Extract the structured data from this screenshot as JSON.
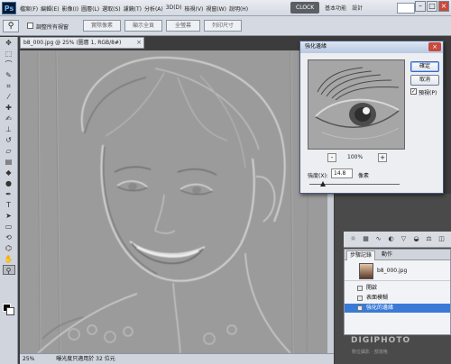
{
  "app": {
    "logo": "Ps"
  },
  "menu": {
    "items": [
      "檔案(F)",
      "編輯(E)",
      "影像(I)",
      "圖層(L)",
      "選取(S)",
      "濾鏡(T)",
      "分析(A)",
      "3D(D)",
      "檢視(V)",
      "視窗(W)",
      "說明(H)"
    ]
  },
  "menubar": {
    "zoom": "25%",
    "workspace_active": "CLOCK",
    "workspace_links": [
      "基本功能",
      "設計"
    ]
  },
  "options": {
    "checkbox_label": "調整所有視窗",
    "buttons": [
      "實際像素",
      "顯示全頁",
      "全螢幕",
      "列印尺寸"
    ]
  },
  "document": {
    "tab_title": "b8_000.jpg @ 25% (圖層 1, RGB/8#)",
    "zoom": "25%",
    "status": "曝光度只適用於 32 位元"
  },
  "dialog": {
    "title": "強化邊緣",
    "ok": "確定",
    "cancel": "取消",
    "preview_label": "預視(P)",
    "preview_checked": true,
    "zoom_minus": "-",
    "zoom_plus": "+",
    "zoom_value": "100%",
    "amount_label": "強度(X):",
    "amount_value": "14.8",
    "amount_unit": "像素",
    "slider_level": 0.15
  },
  "history": {
    "tabs": [
      "步驟記錄",
      "動作"
    ],
    "snapshot": "b8_000.jpg",
    "steps": [
      "開啟",
      "表面模糊",
      "強化的邊緣"
    ],
    "active_step": 2
  },
  "watermark": {
    "text": "DIGIPHOTO",
    "sub": "數位攝影 · 部落格"
  },
  "colors": {
    "accent": "#3a7ad6",
    "canvas": "#9a9a9a"
  }
}
